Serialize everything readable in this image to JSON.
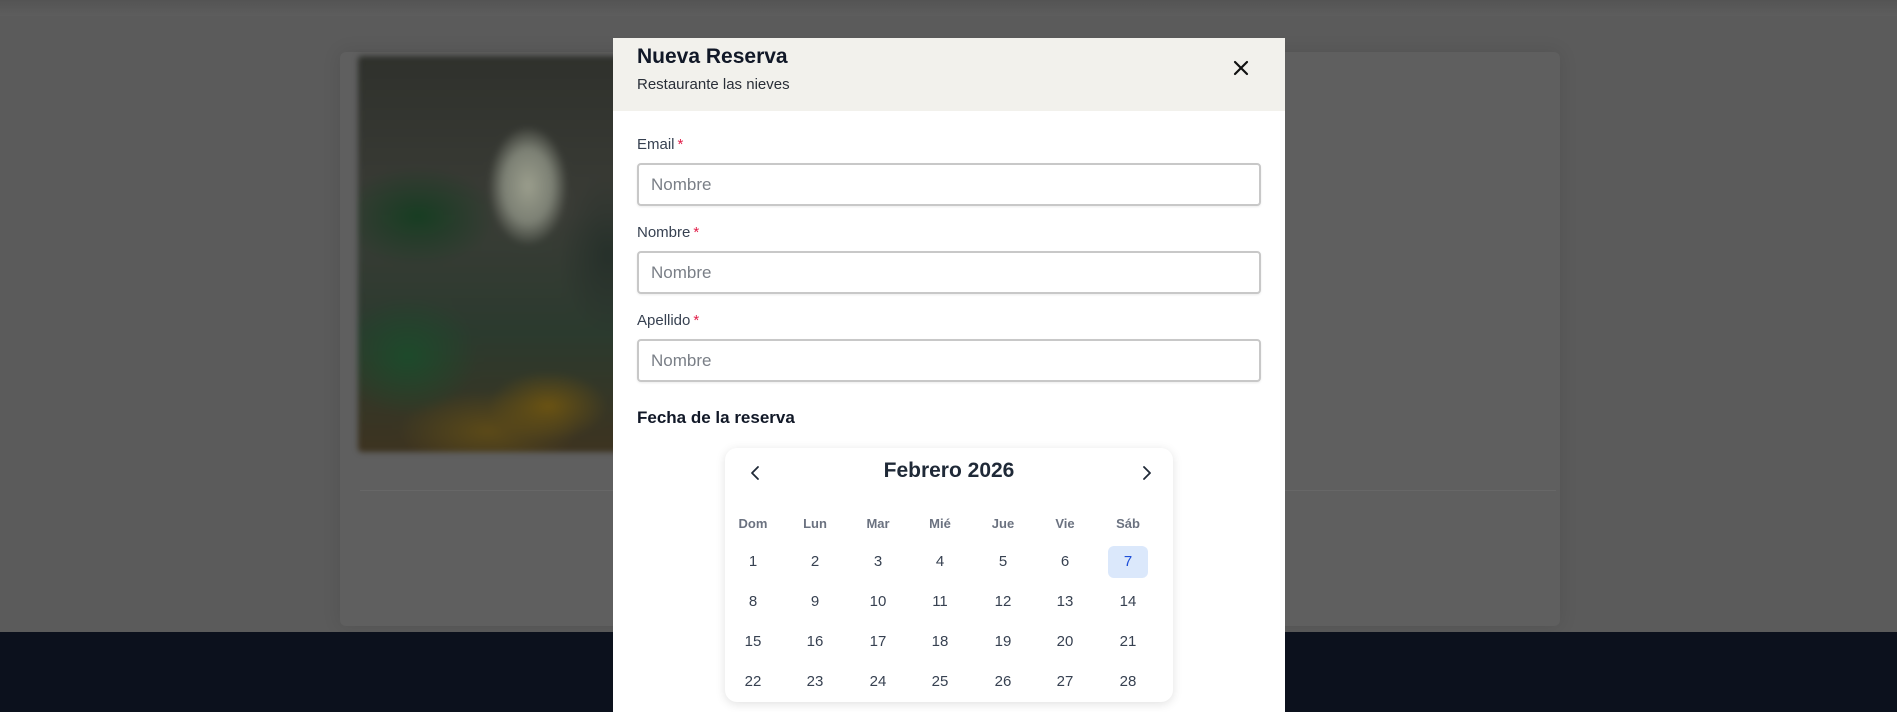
{
  "modal": {
    "title": "Nueva Reserva",
    "subtitle": "Restaurante las nieves"
  },
  "form": {
    "fields": [
      {
        "label": "Email",
        "required_mark": "*",
        "placeholder": "Nombre",
        "value": ""
      },
      {
        "label": "Nombre",
        "required_mark": "*",
        "placeholder": "Nombre",
        "value": ""
      },
      {
        "label": "Apellido",
        "required_mark": "*",
        "placeholder": "Nombre",
        "value": ""
      }
    ],
    "date_section_title": "Fecha de la reserva"
  },
  "calendar": {
    "month_label": "Febrero 2026",
    "weekdays": [
      "Dom",
      "Lun",
      "Mar",
      "Mié",
      "Jue",
      "Vie",
      "Sáb"
    ],
    "weeks": [
      [
        "1",
        "2",
        "3",
        "4",
        "5",
        "6",
        "7"
      ],
      [
        "8",
        "9",
        "10",
        "11",
        "12",
        "13",
        "14"
      ],
      [
        "15",
        "16",
        "17",
        "18",
        "19",
        "20",
        "21"
      ],
      [
        "22",
        "23",
        "24",
        "25",
        "26",
        "27",
        "28"
      ]
    ],
    "selected_day": "7"
  },
  "colors": {
    "header_bg": "#f2f1ec",
    "required": "#e11d48",
    "selected_day_bg": "#dbe8fb",
    "overlay": "#5b5b5b",
    "footer": "#0c111d"
  },
  "icons": {
    "close": "close-icon",
    "prev": "chevron-left-icon",
    "next": "chevron-right-icon"
  }
}
